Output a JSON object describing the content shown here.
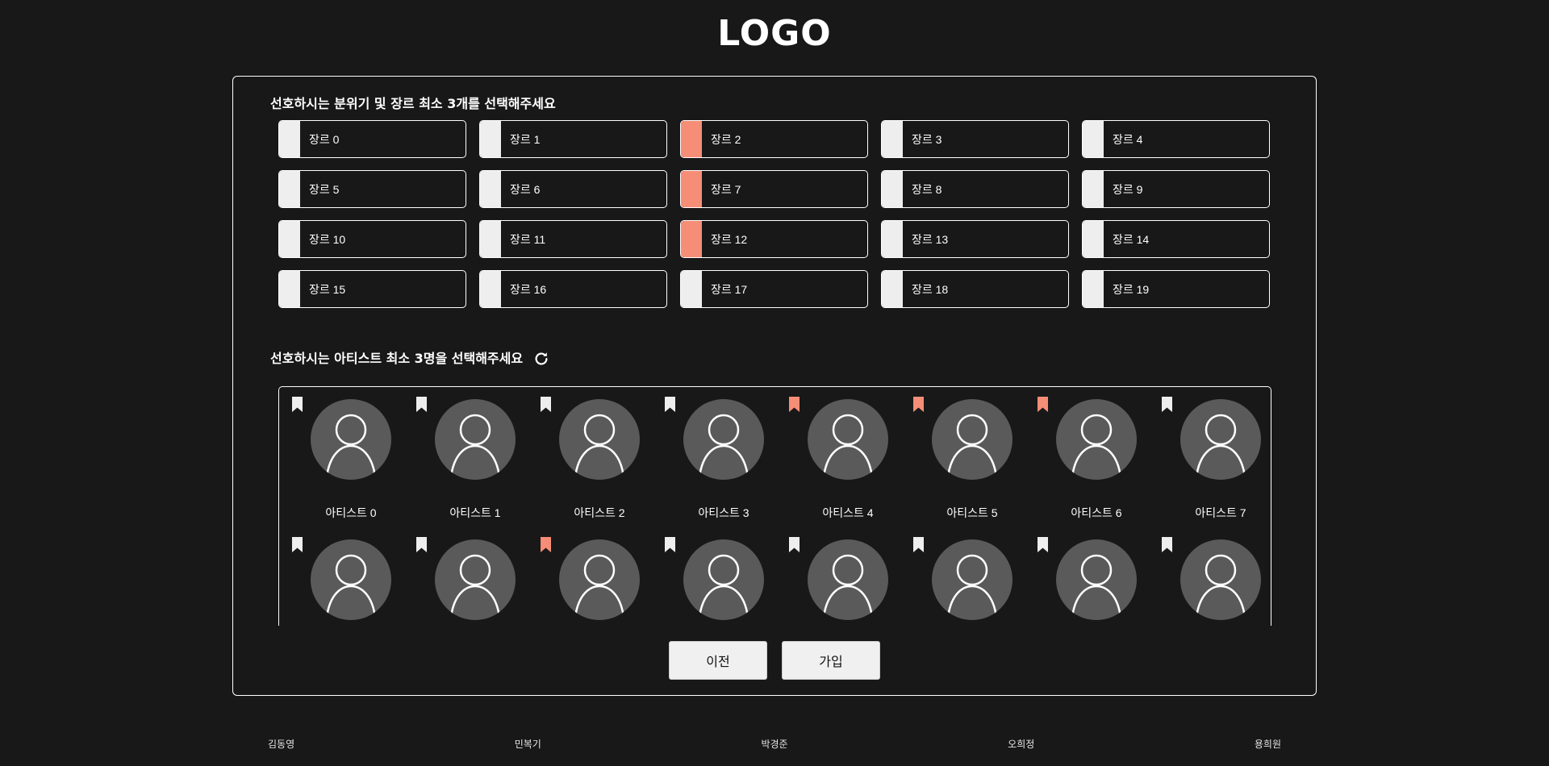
{
  "logo": "LOGO",
  "genre_section": {
    "title": "선호하시는 분위기 및 장르 최소 3개를 선택해주세요",
    "items": [
      {
        "label": "장르 0",
        "selected": false
      },
      {
        "label": "장르 1",
        "selected": false
      },
      {
        "label": "장르 2",
        "selected": true
      },
      {
        "label": "장르 3",
        "selected": false
      },
      {
        "label": "장르 4",
        "selected": false
      },
      {
        "label": "장르 5",
        "selected": false
      },
      {
        "label": "장르 6",
        "selected": false
      },
      {
        "label": "장르 7",
        "selected": true
      },
      {
        "label": "장르 8",
        "selected": false
      },
      {
        "label": "장르 9",
        "selected": false
      },
      {
        "label": "장르 10",
        "selected": false
      },
      {
        "label": "장르 11",
        "selected": false
      },
      {
        "label": "장르 12",
        "selected": true
      },
      {
        "label": "장르 13",
        "selected": false
      },
      {
        "label": "장르 14",
        "selected": false
      },
      {
        "label": "장르 15",
        "selected": false
      },
      {
        "label": "장르 16",
        "selected": false
      },
      {
        "label": "장르 17",
        "selected": false
      },
      {
        "label": "장르 18",
        "selected": false
      },
      {
        "label": "장르 19",
        "selected": false
      }
    ]
  },
  "artist_section": {
    "title": "선호하시는 아티스트 최소 3명을 선택해주세요",
    "refresh_icon": "refresh-icon",
    "items": [
      {
        "name": "아티스트 0",
        "selected": false
      },
      {
        "name": "아티스트 1",
        "selected": false
      },
      {
        "name": "아티스트 2",
        "selected": false
      },
      {
        "name": "아티스트 3",
        "selected": false
      },
      {
        "name": "아티스트 4",
        "selected": true
      },
      {
        "name": "아티스트 5",
        "selected": true
      },
      {
        "name": "아티스트 6",
        "selected": true
      },
      {
        "name": "아티스트 7",
        "selected": false
      },
      {
        "name": "",
        "selected": false
      },
      {
        "name": "",
        "selected": false
      },
      {
        "name": "",
        "selected": true
      },
      {
        "name": "",
        "selected": false
      },
      {
        "name": "",
        "selected": false
      },
      {
        "name": "",
        "selected": false
      },
      {
        "name": "",
        "selected": false
      },
      {
        "name": "",
        "selected": false
      }
    ]
  },
  "buttons": {
    "prev_label": "이전",
    "join_label": "가입"
  },
  "footer": [
    "김동영",
    "민복기",
    "박경준",
    "오희정",
    "용희원"
  ],
  "colors": {
    "background": "#181818",
    "accent": "#f68d76",
    "unselected": "#eeeeee",
    "avatar": "#5a5a5a"
  }
}
